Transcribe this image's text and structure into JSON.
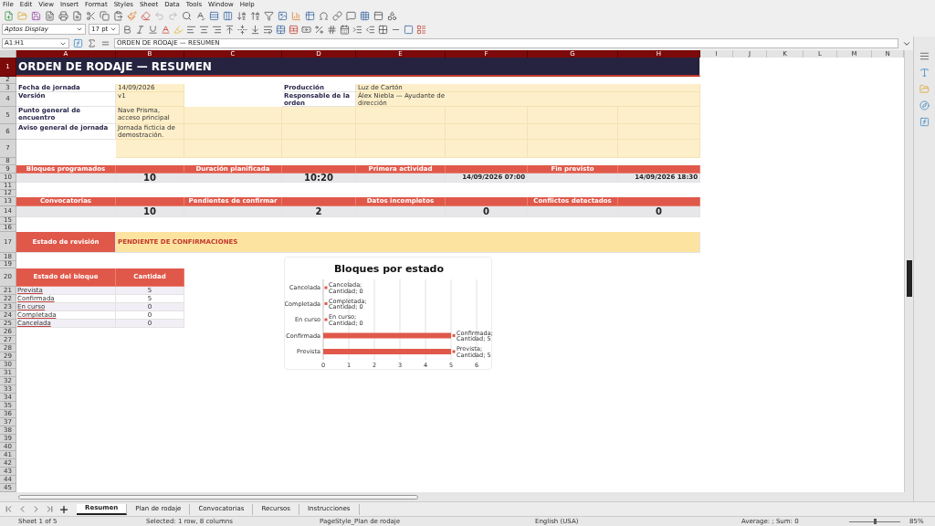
{
  "menu": [
    "File",
    "Edit",
    "View",
    "Insert",
    "Format",
    "Styles",
    "Sheet",
    "Data",
    "Tools",
    "Window",
    "Help"
  ],
  "font_name": "Aptos Display",
  "font_size": "17 pt",
  "formula_bar": {
    "name_box": "A1:H1",
    "content": "ORDEN DE RODAJE — RESUMEN"
  },
  "columns": [
    {
      "label": "A",
      "selected": true
    },
    {
      "label": "B",
      "selected": true
    },
    {
      "label": "C",
      "selected": true
    },
    {
      "label": "D",
      "selected": true
    },
    {
      "label": "E",
      "selected": true
    },
    {
      "label": "F",
      "selected": true
    },
    {
      "label": "G",
      "selected": true
    },
    {
      "label": "H",
      "selected": true
    },
    {
      "label": "I",
      "selected": false
    },
    {
      "label": "J",
      "selected": false
    },
    {
      "label": "K",
      "selected": false
    },
    {
      "label": "L",
      "selected": false
    },
    {
      "label": "M",
      "selected": false
    },
    {
      "label": "N",
      "selected": false
    }
  ],
  "rows": [
    {
      "label": "1",
      "selected": true
    },
    {
      "label": "2",
      "selected": false
    },
    {
      "label": "3",
      "selected": false
    },
    {
      "label": "4",
      "selected": false
    },
    {
      "label": "5",
      "selected": false
    },
    {
      "label": "6",
      "selected": false
    },
    {
      "label": "7",
      "selected": false
    },
    {
      "label": "8",
      "selected": false
    },
    {
      "label": "9",
      "selected": false
    },
    {
      "label": "10",
      "selected": false
    },
    {
      "label": "11",
      "selected": false
    },
    {
      "label": "12",
      "selected": false
    },
    {
      "label": "13",
      "selected": false
    },
    {
      "label": "14",
      "selected": false
    },
    {
      "label": "15",
      "selected": false
    },
    {
      "label": "16",
      "selected": false
    },
    {
      "label": "17",
      "selected": false
    },
    {
      "label": "18",
      "selected": false
    },
    {
      "label": "19",
      "selected": false
    },
    {
      "label": "20",
      "selected": false
    },
    {
      "label": "21",
      "selected": false
    },
    {
      "label": "22",
      "selected": false
    },
    {
      "label": "23",
      "selected": false
    },
    {
      "label": "24",
      "selected": false
    },
    {
      "label": "25",
      "selected": false
    },
    {
      "label": "26",
      "selected": false
    },
    {
      "label": "27",
      "selected": false
    },
    {
      "label": "28",
      "selected": false
    },
    {
      "label": "29",
      "selected": false
    },
    {
      "label": "30",
      "selected": false
    },
    {
      "label": "31",
      "selected": false
    },
    {
      "label": "32",
      "selected": false
    },
    {
      "label": "33",
      "selected": false
    },
    {
      "label": "34",
      "selected": false
    },
    {
      "label": "35",
      "selected": false
    },
    {
      "label": "36",
      "selected": false
    },
    {
      "label": "37",
      "selected": false
    },
    {
      "label": "38",
      "selected": false
    },
    {
      "label": "39",
      "selected": false
    },
    {
      "label": "40",
      "selected": false
    },
    {
      "label": "41",
      "selected": false
    },
    {
      "label": "42",
      "selected": false
    },
    {
      "label": "43",
      "selected": false
    },
    {
      "label": "44",
      "selected": false
    },
    {
      "label": "45",
      "selected": false
    }
  ],
  "sheet": {
    "title": "ORDEN DE RODAJE — RESUMEN",
    "info_left": [
      {
        "label": "Fecha de jornada",
        "value": "14/09/2026"
      },
      {
        "label": "Versión",
        "value": "v1"
      },
      {
        "label": "Punto general de encuentro",
        "value": "Nave Prisma, acceso principal"
      },
      {
        "label": "Aviso general de jornada",
        "value": "Jornada ficticia de demostración."
      }
    ],
    "info_right": [
      {
        "label": "Producción",
        "value": "Luz de Cartón"
      },
      {
        "label": "Responsable de la orden",
        "value": "Álex Niebla — Ayudante de dirección"
      }
    ],
    "kpi_rows": [
      [
        {
          "label": "Bloques programados",
          "value": "10",
          "kind": "number"
        },
        {
          "label": "Duración planificada",
          "value": "10:20",
          "kind": "number"
        },
        {
          "label": "Primera actividad",
          "value": "14/09/2026 07:00",
          "kind": "date"
        },
        {
          "label": "Fin previsto",
          "value": "14/09/2026 18:30",
          "kind": "date"
        }
      ],
      [
        {
          "label": "Convocatorias",
          "value": "10",
          "kind": "number"
        },
        {
          "label": "Pendientes de confirmar",
          "value": "2",
          "kind": "number"
        },
        {
          "label": "Datos incompletos",
          "value": "0",
          "kind": "number"
        },
        {
          "label": "Conflictos detectados",
          "value": "0",
          "kind": "number"
        }
      ]
    ],
    "review": {
      "label": "Estado de revisión",
      "value": "PENDIENTE DE CONFIRMACIONES"
    },
    "status_table": {
      "columns": [
        "Estado del bloque",
        "Cantidad"
      ],
      "rows": [
        [
          "Prevista",
          "5"
        ],
        [
          "Confirmada",
          "5"
        ],
        [
          "En curso",
          "0"
        ],
        [
          "Completada",
          "0"
        ],
        [
          "Cancelada",
          "0"
        ]
      ]
    },
    "chart": {
      "chart_data": {
        "type": "bar",
        "orientation": "horizontal",
        "title": "Bloques por estado",
        "categories": [
          "Cancelada",
          "Completada",
          "En curso",
          "Confirmada",
          "Prevista"
        ],
        "series": [
          {
            "color": "#e0584a",
            "values": [
              0,
              0,
              0,
              5,
              5
            ]
          }
        ],
        "xlim": [
          0,
          6
        ],
        "xticks": [
          0,
          1,
          2,
          3,
          4,
          5,
          6
        ],
        "grid": true,
        "value_labels": [
          "Cancelada; Cantidad; 0",
          "Completada; Cantidad; 0",
          "En curso; Cantidad; 0",
          "Confirmada; Cantidad; 5",
          "Prevista; Cantidad; 5"
        ]
      }
    }
  },
  "sheet_tabs": [
    {
      "label": "Resumen",
      "selected": true
    },
    {
      "label": "Plan de rodaje",
      "selected": false
    },
    {
      "label": "Convocatorias",
      "selected": false
    },
    {
      "label": "Recursos",
      "selected": false
    },
    {
      "label": "Instrucciones",
      "selected": false
    }
  ],
  "status_bar": {
    "sheet": "Sheet 1 of 5",
    "selection": "Selected: 1 row, 8 columns",
    "page_style": "PageStyle_Plan de rodaje",
    "language": "English (USA)",
    "summary": "Average: ; Sum: 0",
    "zoom": {
      "level": 0.5,
      "reading": "85%"
    }
  }
}
